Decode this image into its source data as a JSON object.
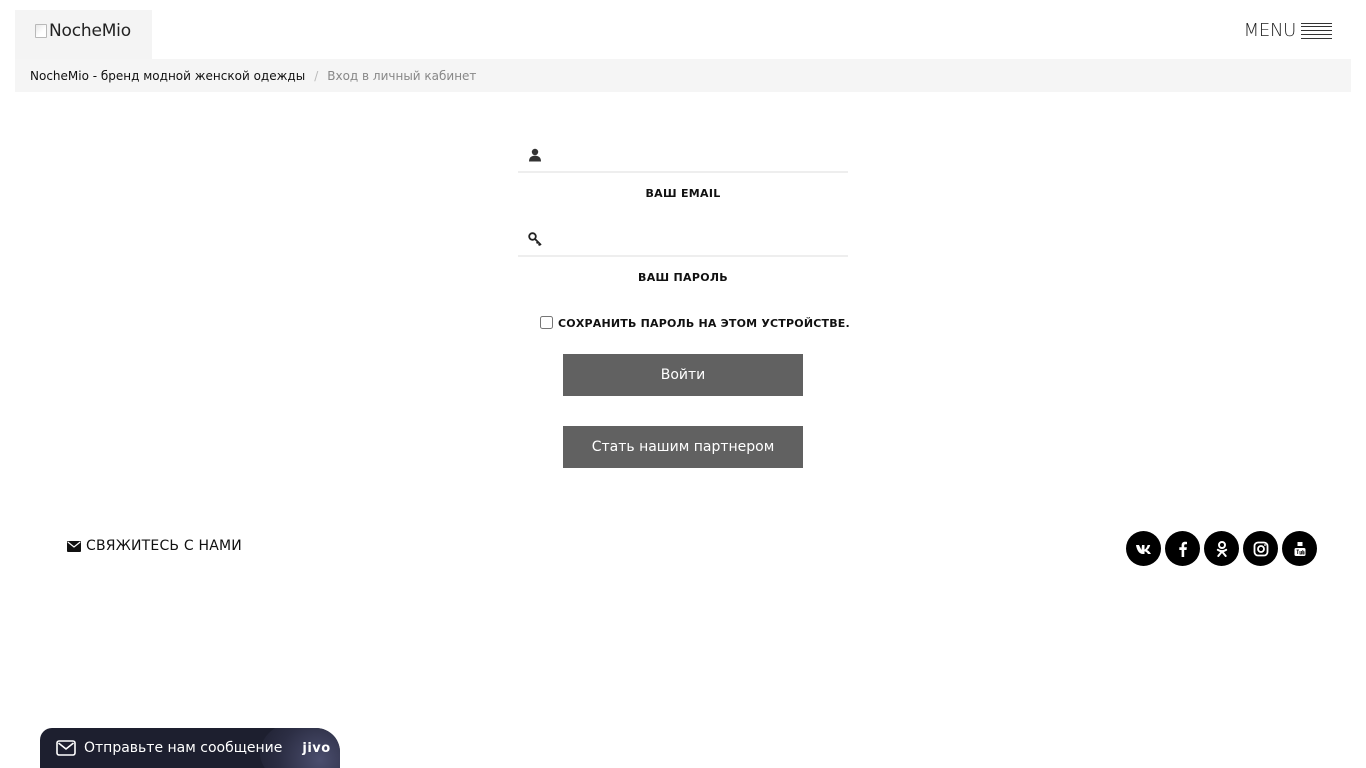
{
  "header": {
    "logo_alt": "NocheMio",
    "menu_label": "MENU"
  },
  "breadcrumb": {
    "home": "NocheMio - бренд модной женской одежды",
    "separator": "/",
    "current": "Вход в личный кабинет"
  },
  "login": {
    "email_value": "",
    "email_label": "ВАШ EMAIL",
    "password_value": "",
    "password_label": "ВАШ ПАРОЛЬ",
    "remember_label": "СОХРАНИТЬ ПАРОЛЬ НА ЭТОМ УСТРОЙСТВЕ.",
    "remember_checked": false,
    "login_button": "Войти",
    "partner_button": "Стать нашим партнером"
  },
  "footer": {
    "contact_label": "СВЯЖИТЕСЬ С НАМИ",
    "social": [
      "vk-icon",
      "facebook-icon",
      "odnoklassniki-icon",
      "instagram-icon",
      "youtube-icon"
    ]
  },
  "chat": {
    "label": "Отправьте нам сообщение",
    "brand": "jivo"
  },
  "colors": {
    "button_bg": "#616161",
    "breadcrumb_bg": "#f5f5f5",
    "social_bg": "#000000",
    "chat_bg": "#1d1f2f"
  }
}
